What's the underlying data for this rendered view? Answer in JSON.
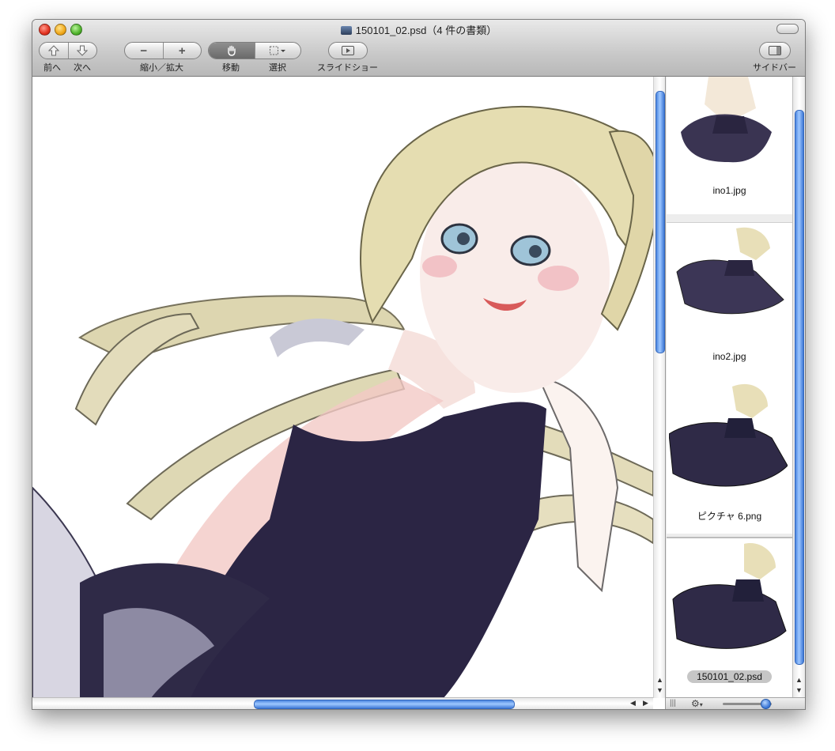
{
  "window": {
    "title": "150101_02.psd（4 件の書類）"
  },
  "toolbar": {
    "prev_label": "前へ",
    "next_label": "次へ",
    "zoom_label": "縮小／拡大",
    "zoom_out_glyph": "−",
    "zoom_in_glyph": "+",
    "move_label": "移動",
    "select_label": "選択",
    "slideshow_label": "スライドショー",
    "sidebar_label": "サイドバー"
  },
  "sidebar": {
    "items": [
      {
        "name": "ino1.jpg",
        "selected": false
      },
      {
        "name": "ino2.jpg",
        "selected": false
      },
      {
        "name": "ピクチャ 6.png",
        "selected": false
      },
      {
        "name": "150101_02.psd",
        "selected": true
      }
    ],
    "thumbnail_size_fraction": 0.95
  },
  "scroll": {
    "main_vertical_fraction": 0.0,
    "main_horizontal_fraction": 0.4,
    "sidebar_vertical_fraction": 0.05
  },
  "colors": {
    "accent": "#3e78d6",
    "dress": "#2b2544",
    "hair": "#e5ddb1",
    "skin": "#f8e7e2"
  },
  "icons": {
    "prev": "up-arrow-icon",
    "next": "down-arrow-icon",
    "move": "hand-icon",
    "select": "marquee-select-icon",
    "slideshow": "play-icon",
    "sidebar": "sidebar-panel-icon",
    "action": "gear-icon"
  }
}
